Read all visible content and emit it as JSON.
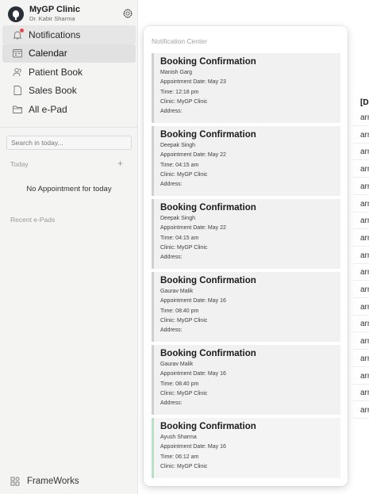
{
  "sidebar": {
    "clinic_name": "MyGP Clinic",
    "doctor_name": "Dr. Kabir Sharma",
    "nav": [
      {
        "label": "Notifications",
        "icon": "bell-icon"
      },
      {
        "label": "Calendar",
        "icon": "calendar-icon"
      },
      {
        "label": "Patient Book",
        "icon": "people-icon"
      },
      {
        "label": "Sales Book",
        "icon": "document-icon"
      },
      {
        "label": "All e-Pad",
        "icon": "folder-icon"
      }
    ],
    "search_placeholder": "Search in today...",
    "today_label": "Today",
    "add_symbol": "+",
    "no_appointment": "No Appointment for today",
    "recent_label": "Recent e-Pads",
    "footer_label": "FrameWorks"
  },
  "background": {
    "column_header": "[Doct",
    "cells": [
      "arma",
      "arma",
      "arma",
      "arma",
      "arma",
      "arma",
      "arma",
      "arma",
      "arma",
      "arma",
      "arma",
      "arma",
      "arma",
      "arma",
      "arma",
      "arma",
      "arma",
      "arma"
    ]
  },
  "notifications": {
    "title": "Notification Center",
    "cards": [
      {
        "title": "Booking Confirmation",
        "patient": "Manish Garg",
        "date": "Appointment Date: May 23",
        "time": "Time: 12:18 pm",
        "clinic": "Clinic: MyGP Clinic",
        "address": "Address:"
      },
      {
        "title": "Booking Confirmation",
        "patient": "Deepak Singh",
        "date": "Appointment Date: May 22",
        "time": "Time: 04:15 am",
        "clinic": "Clinic: MyGP Clinic",
        "address": "Address:"
      },
      {
        "title": "Booking Confirmation",
        "patient": "Deepak Singh",
        "date": "Appointment Date: May 22",
        "time": "Time: 04:15 am",
        "clinic": "Clinic: MyGP Clinic",
        "address": "Address:"
      },
      {
        "title": "Booking Confirmation",
        "patient": "Gaurav Malik",
        "date": "Appointment Date: May 16",
        "time": "Time: 08:40 pm",
        "clinic": "Clinic: MyGP Clinic",
        "address": "Address:"
      },
      {
        "title": "Booking Confirmation",
        "patient": "Gaurav Malik",
        "date": "Appointment Date: May 16",
        "time": "Time: 08:40 pm",
        "clinic": "Clinic: MyGP Clinic",
        "address": "Address:"
      },
      {
        "title": "Booking Confirmation",
        "patient": "Ayush Sharma",
        "date": "Appointment Date: May 16",
        "time": "Time: 06:12 am",
        "clinic": "Clinic: MyGP Clinic"
      }
    ]
  }
}
